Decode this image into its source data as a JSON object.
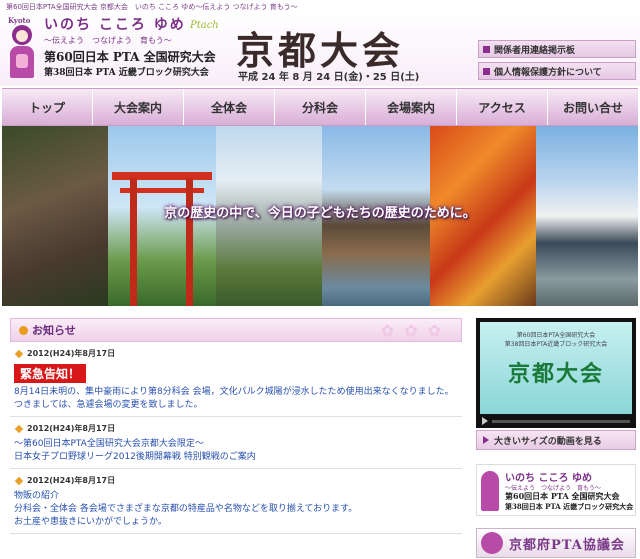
{
  "top_strip": "第60回日本PTA全国研究大会 京都大会　いのち こころ ゆめ〜伝えよう つなげよう 育もう〜",
  "header": {
    "kyoto_badge": "Kyoto",
    "slogan_main": "いのち こころ ゆめ",
    "slogan_sub": "〜伝えよう　つなげよう　育もう〜",
    "ptach": "Ptach",
    "conf_line1": "第60回日本 PTA 全国研究大会",
    "conf_line2": "第38回日本 PTA 近畿ブロック研究大会",
    "title": "京都大会",
    "date": "平成 24 年 8 月 24 日(金)・25 日(土)"
  },
  "side_links": [
    {
      "label": "関係者用連絡掲示板"
    },
    {
      "label": "個人情報保護方針について"
    }
  ],
  "nav": [
    {
      "label": "トップ"
    },
    {
      "label": "大会案内"
    },
    {
      "label": "全体会"
    },
    {
      "label": "分科会"
    },
    {
      "label": "会場案内"
    },
    {
      "label": "アクセス"
    },
    {
      "label": "お問い合せ"
    }
  ],
  "hero": {
    "caption": "京の歴史の中で、今日の子どもたちの歴史のために。"
  },
  "news": {
    "heading": "お知らせ",
    "entries": [
      {
        "date": "2012(H24)年8月17日",
        "badge": "緊急告知！",
        "lines": [
          "8月14日未明の、集中豪雨により第8分科会 会場，文化パルク城陽が浸水したため使用出来なくなりました。",
          "つきましては、急遽会場の変更を致しました。"
        ]
      },
      {
        "date": "2012(H24)年8月17日",
        "lines": [
          "〜第60回日本PTA全国研究大会京都大会限定〜",
          "日本女子プロ野球リーグ2012後期開幕戦 特別観戦のご案内"
        ]
      },
      {
        "date": "2012(H24)年8月17日",
        "lines": [
          "物販の紹介",
          "分科会・全体会 各会場でさまざまな京都の特産品や名物などを取り揃えております。",
          "お土産や患抜きにいかがでしょうか。"
        ]
      }
    ]
  },
  "video": {
    "small_text_1": "第60回日本PTA全国研究大会",
    "small_text_2": "第38回日本PTA近畿ブロック研究大会",
    "title": "京都大会",
    "bigger_link": "大きいサイズの動画を見る"
  },
  "banner1": {
    "slogan_main": "いのち こころ ゆめ",
    "slogan_sub": "〜伝えよう　つなげよう　育もう〜",
    "conf_line1": "第60回日本 PTA 全国研究大会",
    "conf_line2": "第38回日本 PTA 近畿ブロック研究大会"
  },
  "banner2": {
    "label": "京都府PTA協議会"
  },
  "colors": {
    "brand_purple": "#8b2e8e",
    "nav_gradient_bottom": "#d9aed6",
    "urgent_red": "#d81818",
    "link_blue": "#2850b0",
    "date_orange": "#e8a02a"
  }
}
